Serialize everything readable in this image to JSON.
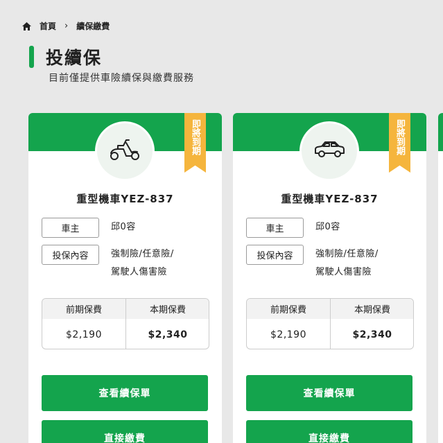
{
  "breadcrumb": {
    "home": "首頁",
    "separator": "›",
    "current": "續保繳費"
  },
  "header": {
    "title": "投續保",
    "subtitle": "目前僅提供車險續保與繳費服務"
  },
  "colors": {
    "accent": "#14a44d",
    "ribbon": "#f5b53d",
    "background": "#e8e8e8"
  },
  "cards": [
    {
      "icon": "scooter-icon",
      "ribbon": "即將到期",
      "vehicle": "重型機車YEZ-837",
      "owner_label": "車主",
      "owner_value": "邱0容",
      "coverage_label": "投保內容",
      "coverage_line1": "強制險/任意險/",
      "coverage_line2": "駕駛人傷害險",
      "prev_label": "前期保費",
      "curr_label": "本期保費",
      "prev_value": "$2,190",
      "curr_value": "$2,340",
      "view_button": "查看續保單",
      "pay_button": "直接繳費"
    },
    {
      "icon": "car-icon",
      "ribbon": "即將到期",
      "vehicle": "重型機車YEZ-837",
      "owner_label": "車主",
      "owner_value": "邱0容",
      "coverage_label": "投保內容",
      "coverage_line1": "強制險/任意險/",
      "coverage_line2": "駕駛人傷害險",
      "prev_label": "前期保費",
      "curr_label": "本期保費",
      "prev_value": "$2,190",
      "curr_value": "$2,340",
      "view_button": "查看續保單",
      "pay_button": "直接繳費"
    }
  ]
}
